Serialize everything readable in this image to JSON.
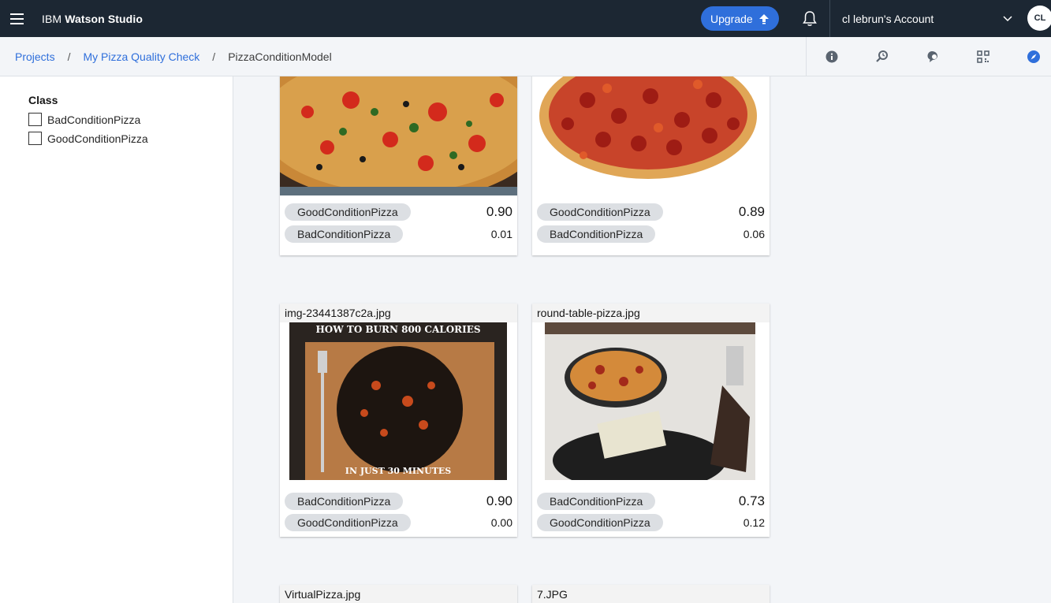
{
  "header": {
    "brand_prefix": "IBM",
    "brand_name": "Watson Studio",
    "upgrade_label": "Upgrade",
    "account_label": "cl lebrun's Account",
    "avatar_initials": "CL"
  },
  "breadcrumb": {
    "items": [
      "Projects",
      "My Pizza Quality Check"
    ],
    "current": "PizzaConditionModel",
    "separator": "/"
  },
  "sidebar": {
    "heading": "Class",
    "filters": [
      "BadConditionPizza",
      "GoodConditionPizza"
    ]
  },
  "cards": [
    {
      "filename": "",
      "predictions": [
        {
          "label": "GoodConditionPizza",
          "score": "0.90"
        },
        {
          "label": "BadConditionPizza",
          "score": "0.01"
        }
      ]
    },
    {
      "filename": "",
      "predictions": [
        {
          "label": "GoodConditionPizza",
          "score": "0.89"
        },
        {
          "label": "BadConditionPizza",
          "score": "0.06"
        }
      ]
    },
    {
      "filename": "img-23441387c2a.jpg",
      "image_text_top": "HOW TO BURN 800 CALORIES",
      "image_text_bottom": "IN JUST 30 MINUTES",
      "predictions": [
        {
          "label": "BadConditionPizza",
          "score": "0.90"
        },
        {
          "label": "GoodConditionPizza",
          "score": "0.00"
        }
      ]
    },
    {
      "filename": "round-table-pizza.jpg",
      "predictions": [
        {
          "label": "BadConditionPizza",
          "score": "0.73"
        },
        {
          "label": "GoodConditionPizza",
          "score": "0.12"
        }
      ]
    },
    {
      "filename": "VirtualPizza.jpg",
      "predictions": []
    },
    {
      "filename": "7.JPG",
      "predictions": []
    }
  ],
  "colors": {
    "header_bg": "#1c2733",
    "accent": "#2f6fdb",
    "tag_bg": "#dcdfe3"
  }
}
